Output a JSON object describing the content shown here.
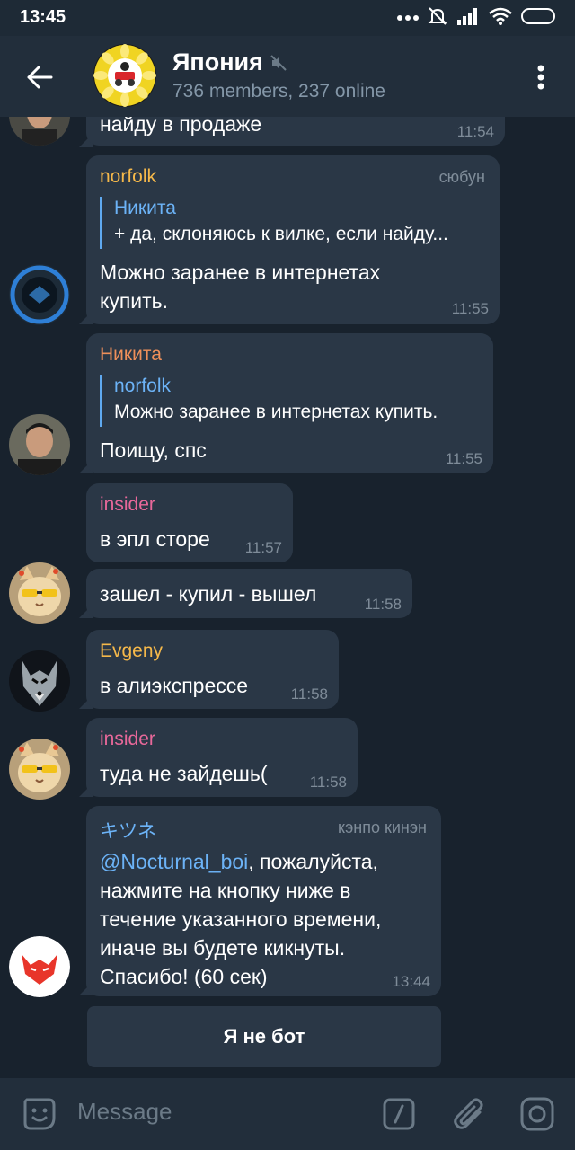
{
  "status_bar": {
    "time": "13:45"
  },
  "header": {
    "title": "Япония",
    "subtitle": "736 members, 237 online"
  },
  "messages": [
    {
      "text": "найду в продаже",
      "time": "11:54"
    },
    {
      "sender": "norfolk",
      "sender_color": "#f5b84a",
      "admin_tag": "сюбун",
      "reply": {
        "name": "Никита",
        "text": "+ да, склоняюсь к вилке, если найду..."
      },
      "text": "Можно заранее в интернетах\nкупить.",
      "time": "11:55"
    },
    {
      "sender": "Никита",
      "sender_color": "#f0905a",
      "reply": {
        "name": "norfolk",
        "text": "Можно заранее в интернетах купить."
      },
      "text": "Поищу, спс",
      "time": "11:55"
    },
    {
      "sender": "insider",
      "sender_color": "#e8689a",
      "text": "в эпл сторе",
      "time": "11:57"
    },
    {
      "text": "зашел - купил - вышел",
      "time": "11:58"
    },
    {
      "sender": "Evgeny",
      "sender_color": "#f5b84a",
      "text": "в алиэкспрессе",
      "time": "11:58"
    },
    {
      "sender": "insider",
      "sender_color": "#e8689a",
      "text": "туда не зайдешь(",
      "time": "11:58"
    },
    {
      "sender": "キツネ",
      "sender_color": "#6cb3f7",
      "admin_tag": "кэнпо кинэн",
      "mention": "@Nocturnal_boi",
      "text": ", пожалуйста,\nнажмите на кнопку ниже в\nтечение указанного времени,\nиначе вы будете кикнуты.\nСпасибо! (60 сек)",
      "time": "13:44"
    }
  ],
  "bot_button": {
    "label": "Я не бот"
  },
  "input": {
    "placeholder": "Message"
  }
}
